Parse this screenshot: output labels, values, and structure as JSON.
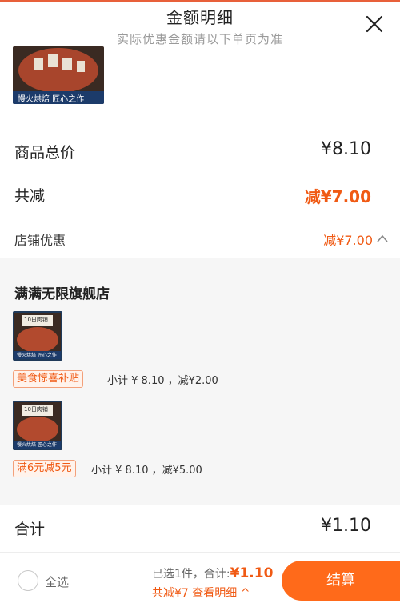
{
  "header": {
    "title": "金额明细",
    "subtitle": "实际优惠金额请以下单页为准"
  },
  "top_image": {
    "caption": "慢火烘焙 匠心之作"
  },
  "summary": {
    "total_label": "商品总价",
    "total_value": "¥8.10",
    "reduce_label": "共减",
    "reduce_value": "减¥7.00",
    "store_label": "店铺优惠",
    "store_value": "减¥7.00"
  },
  "shop": {
    "name": "满满无限旗舰店",
    "items": [
      {
        "thumb_title": "10日肉铺",
        "thumb_sub": "慢火烘焙 匠心之作",
        "promo": "美食惊喜补贴",
        "subtotal": "小计 ¥ 8.10 ，减¥2.00"
      },
      {
        "thumb_title": "10日肉铺",
        "thumb_sub": "慢火烘焙 匠心之作",
        "promo": "满6元减5元",
        "subtotal": "小计 ¥ 8.10 ，减¥5.00"
      }
    ]
  },
  "footer": {
    "sum_label": "合计",
    "sum_value": "¥1.10",
    "select_all": "全选",
    "selected_prefix": "已选1件，合计:",
    "selected_amount": "¥1.10",
    "reduce_link": "共减¥7 查看明细 ^",
    "checkout": "结算"
  },
  "colors": {
    "accent": "#f05a14",
    "checkout": "#ff6a1a",
    "panel_bg": "#f6f6f6"
  }
}
